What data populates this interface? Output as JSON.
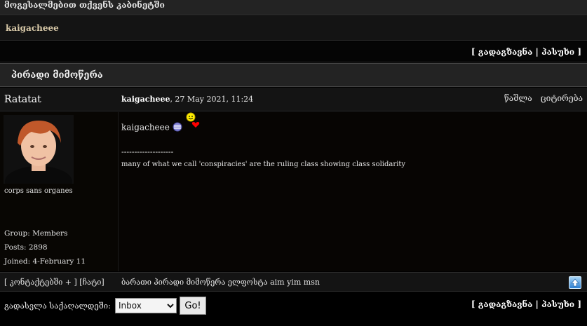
{
  "header": {
    "title": "მოგესალმებით თქვენს კაბინეტში"
  },
  "user_bar": {
    "username": "kaigacheee"
  },
  "top_actions": {
    "forward": "გადაგზავნა",
    "reply": "პასუხი"
  },
  "section": {
    "title": "პირადი მიმოწერა"
  },
  "post": {
    "author": "Ratatat",
    "sender": "kaigacheee",
    "date": ", 27 May 2021, 11:24",
    "delete_label": "წაშლა",
    "quote_label": "ციტირება",
    "message": "kaigacheee",
    "sig_separator": "--------------------",
    "signature": "many of what we call 'conspiracies' are the ruling class showing class solidarity",
    "user_title": "corps sans organes",
    "group": "Group: Members",
    "posts": "Posts: 2898",
    "joined": "Joined: 4-February 11"
  },
  "post_footer": {
    "contacts_add": "[ კონტაქტებში + ] [ჩატი]",
    "contacts_info": "ბარათი პირადი მიმოწერა ელფოსტა aim yim msn"
  },
  "bottom": {
    "jump_label": "გადასვლა საქაღალდეში:",
    "folder_selected": "Inbox",
    "go_label": "Go!",
    "forward": "გადაგზავნა",
    "reply": "პასუხი"
  },
  "colors": {
    "background": "#000000",
    "header_bg": "#232323",
    "username_color": "#d8c9a8"
  },
  "icons": [
    "smiley-icon",
    "heart-icon",
    "striped-smiley-icon",
    "scroll-up-icon"
  ]
}
